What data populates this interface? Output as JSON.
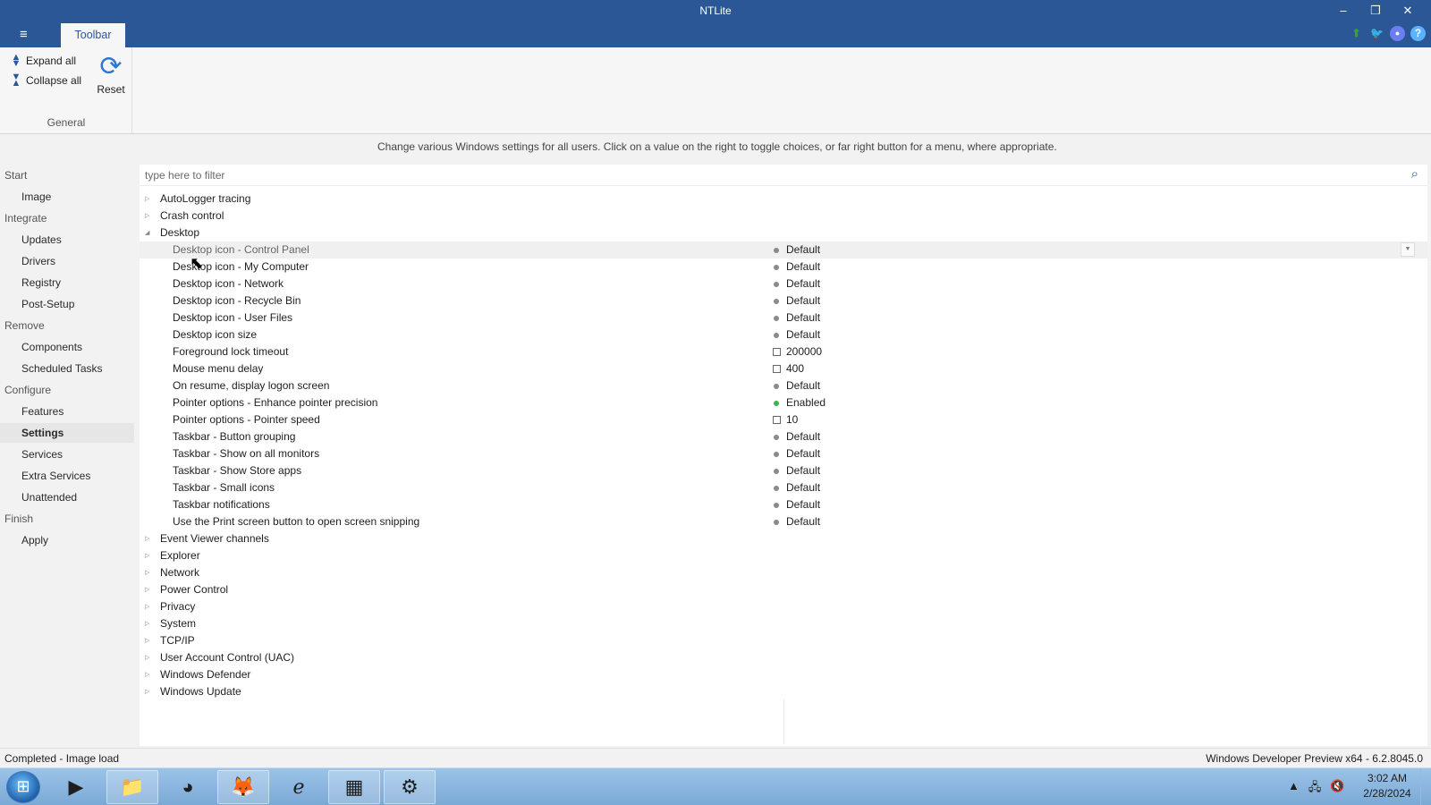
{
  "window": {
    "title": "NTLite",
    "controls": [
      "–",
      "❐",
      "✕"
    ]
  },
  "menu": {
    "hamburger": "≡",
    "tab": "Toolbar"
  },
  "top_icons": [
    "upload-icon",
    "twitter-icon",
    "discord-icon",
    "help-icon"
  ],
  "ribbon": {
    "expand_all": "Expand all",
    "collapse_all": "Collapse all",
    "reset": "Reset",
    "group_label": "General"
  },
  "description": "Change various Windows settings for all users. Click on a value on the right to toggle choices, or far right button for a menu, where appropriate.",
  "nav": {
    "start": "Start",
    "image": "Image",
    "integrate": "Integrate",
    "updates": "Updates",
    "drivers": "Drivers",
    "registry": "Registry",
    "post_setup": "Post-Setup",
    "remove": "Remove",
    "components": "Components",
    "scheduled_tasks": "Scheduled Tasks",
    "configure": "Configure",
    "features": "Features",
    "settings": "Settings",
    "services": "Services",
    "extra_services": "Extra Services",
    "unattended": "Unattended",
    "finish": "Finish",
    "apply": "Apply"
  },
  "filter": {
    "placeholder": "type here to filter"
  },
  "tree": {
    "autologger": "AutoLogger tracing",
    "crash_control": "Crash control",
    "desktop": "Desktop",
    "desktop_children": [
      {
        "label": "Desktop icon - Control Panel",
        "value": "Default"
      },
      {
        "label": "Desktop icon - My Computer",
        "value": "Default"
      },
      {
        "label": "Desktop icon - Network",
        "value": "Default"
      },
      {
        "label": "Desktop icon - Recycle Bin",
        "value": "Default"
      },
      {
        "label": "Desktop icon - User Files",
        "value": "Default"
      },
      {
        "label": "Desktop icon size",
        "value": "Default"
      },
      {
        "label": "Foreground lock timeout",
        "value": "200000"
      },
      {
        "label": "Mouse menu delay",
        "value": "400"
      },
      {
        "label": "On resume, display logon screen",
        "value": "Default"
      },
      {
        "label": "Pointer options - Enhance pointer precision",
        "value": "Enabled"
      },
      {
        "label": "Pointer options - Pointer speed",
        "value": "10"
      },
      {
        "label": "Taskbar - Button grouping",
        "value": "Default"
      },
      {
        "label": "Taskbar - Show on all monitors",
        "value": "Default"
      },
      {
        "label": "Taskbar - Show Store apps",
        "value": "Default"
      },
      {
        "label": "Taskbar - Small icons",
        "value": "Default"
      },
      {
        "label": "Taskbar notifications",
        "value": "Default"
      },
      {
        "label": "Use the Print screen button to open screen snipping",
        "value": "Default"
      }
    ],
    "event_viewer": "Event Viewer channels",
    "explorer": "Explorer",
    "network": "Network",
    "power_control": "Power Control",
    "privacy": "Privacy",
    "system": "System",
    "tcpip": "TCP/IP",
    "uac": "User Account Control (UAC)",
    "defender": "Windows Defender",
    "windows_update": "Windows Update"
  },
  "status": {
    "left": "Completed - Image load",
    "right": "Windows Developer Preview x64 - 6.2.8045.0"
  },
  "taskbar": {
    "time": "3:02 AM",
    "date": "2/28/2024"
  }
}
